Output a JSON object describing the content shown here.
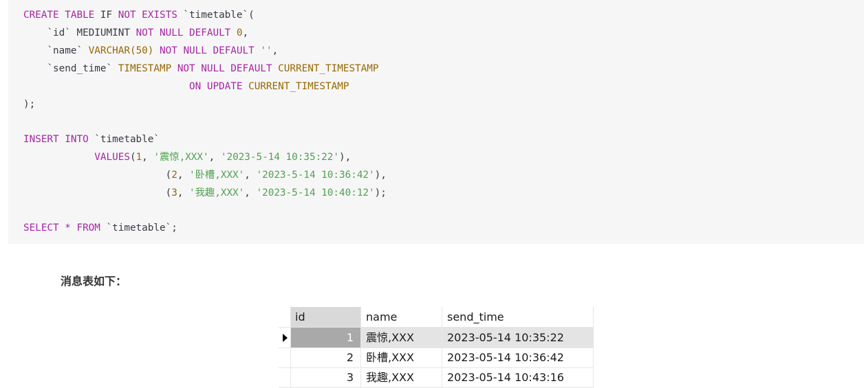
{
  "code": {
    "create_kw1": "CREATE TABLE",
    "create_if": "IF",
    "create_kw2": "NOT EXISTS",
    "create_table": "`timetable`(",
    "col_id_name": "`id`",
    "col_id_type": "MEDIUMINT",
    "col_id_constraint": "NOT NULL DEFAULT",
    "col_id_default": "0",
    "col_id_end": ",",
    "col_name_name": "`name`",
    "col_name_type": "VARCHAR(",
    "col_name_len": "50",
    "col_name_typeclose": ")",
    "col_name_constraint": "NOT NULL DEFAULT",
    "col_name_default": "''",
    "col_name_end": ",",
    "col_time_name": "`send_time`",
    "col_time_type": "TIMESTAMP",
    "col_time_constraint": "NOT NULL DEFAULT",
    "col_time_default": "CURRENT_TIMESTAMP",
    "col_time_on": "ON UPDATE",
    "col_time_update": "CURRENT_TIMESTAMP",
    "create_end": ");",
    "insert_kw": "INSERT INTO",
    "insert_table": "`timetable`",
    "values_kw": "VALUES",
    "values": [
      {
        "open": "(",
        "id": "1",
        "name": "'震惊,XXX'",
        "time": "'2023-5-14 10:35:22'",
        "close": "),"
      },
      {
        "open": "(",
        "id": "2",
        "name": "'卧槽,XXX'",
        "time": "'2023-5-14 10:36:42'",
        "close": "),"
      },
      {
        "open": "(",
        "id": "3",
        "name": "'我趣,XXX'",
        "time": "'2023-5-14 10:40:12'",
        "close": ");"
      }
    ],
    "select_kw": "SELECT * FROM",
    "select_table": "`timetable`;"
  },
  "caption": "消息表如下：",
  "result": {
    "columns": [
      "id",
      "name",
      "send_time"
    ],
    "rows": [
      {
        "id": "1",
        "name": "震惊,XXX",
        "send_time": "2023-05-14 10:35:22"
      },
      {
        "id": "2",
        "name": "卧槽,XXX",
        "send_time": "2023-05-14 10:36:42"
      },
      {
        "id": "3",
        "name": "我趣,XXX",
        "send_time": "2023-05-14 10:43:16"
      }
    ]
  },
  "colors": {
    "keyword": "#a626a4",
    "type": "#986801",
    "string": "#50a14f",
    "code_bg": "#f6f6f7"
  }
}
